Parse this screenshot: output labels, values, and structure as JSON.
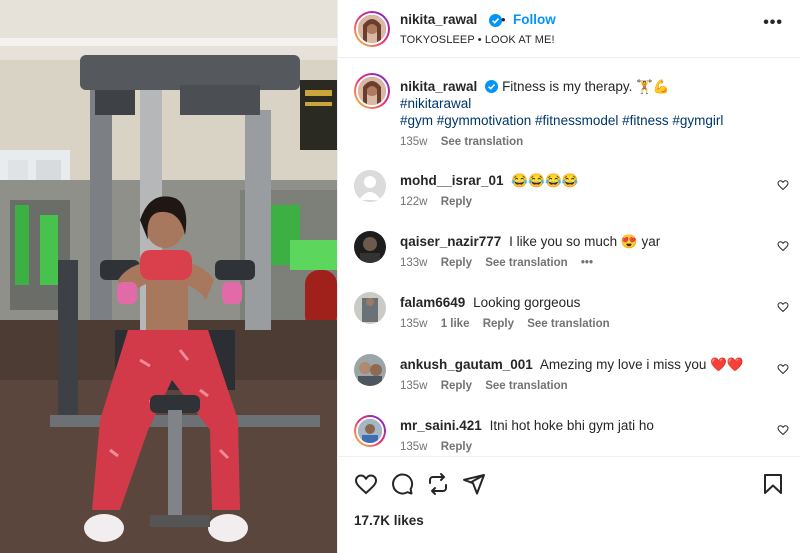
{
  "post": {
    "username": "nikita_rawal",
    "follow_label": "Follow",
    "subtitle": "TOKYOSLEEP • LOOK AT ME!",
    "more_label": "•••"
  },
  "caption": {
    "username": "nikita_rawal",
    "text": "Fitness is my therapy.",
    "emoji": "🏋️💪",
    "hashtag_line1": "#nikitarawal",
    "hashtag_line2": "#gym #gymmotivation #fitnessmodel #fitness #gymgirl",
    "time": "135w",
    "translate": "See translation"
  },
  "comments": [
    {
      "username": "mohd__israr_01",
      "text": "😂😂😂😂",
      "time": "122w",
      "reply": "Reply"
    },
    {
      "username": "qaiser_nazir777",
      "text": "I like you so much 😍 yar",
      "time": "133w",
      "reply": "Reply",
      "translate": "See translation",
      "more": "•••"
    },
    {
      "username": "falam6649",
      "text": "Looking gorgeous",
      "time": "135w",
      "likes": "1 like",
      "reply": "Reply",
      "translate": "See translation"
    },
    {
      "username": "ankush_gautam_001",
      "text": "Amezing my love i miss you ❤️❤️",
      "time": "135w",
      "reply": "Reply",
      "translate": "See translation"
    },
    {
      "username": "mr_saini.421",
      "text": "Itni hot hoke bhi gym jati ho",
      "time": "135w",
      "reply": "Reply"
    }
  ],
  "footer": {
    "likes": "17.7K likes"
  },
  "colors": {
    "accent": "#0095f6",
    "verified": "#0095f6",
    "muted": "#737373",
    "hashtag": "#00376b"
  },
  "icons": [
    "verified-badge-icon",
    "more-icon",
    "heart-icon",
    "comment-icon",
    "repost-icon",
    "share-icon",
    "bookmark-icon"
  ]
}
